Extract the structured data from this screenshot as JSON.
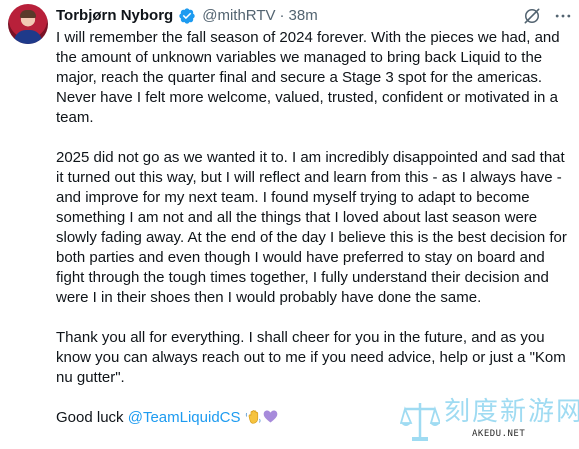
{
  "author": {
    "display_name": "Torbjørn Nyborg",
    "handle": "@mithRTV",
    "separator": "·",
    "time": "38m"
  },
  "icons": {
    "verified": "verified-badge-icon",
    "grok": "grok-icon",
    "more": "more-options-icon"
  },
  "colors": {
    "text": "#0f1419",
    "secondary": "#536471",
    "link": "#1d9bf0",
    "verified": "#1d9bf0"
  },
  "tweet": {
    "paragraphs": [
      "I will remember the fall season of 2024 forever. With the pieces we had, and the amount of unknown variables we managed to bring back Liquid to the major, reach the quarter final and secure a Stage 3 spot for the americas. Never have I felt more welcome, valued, trusted, confident or motivated in a team.",
      "2025 did not go as we wanted it to. I am incredibly disappointed and sad that it turned out this way, but I will reflect and learn from this - as I always have - and improve for my next team. I found myself trying to adapt to become something I am not and all the things that I loved about last season were slowly fading away. At the end of the day I believe this is the best decision for both parties and even though I would have preferred to stay on board and fight through the tough times together, I fully understand their decision and were I in their shoes then I would probably have done the same.",
      "Thank you all for everything. I shall cheer for you in the future, and as you know you can always reach out to me if you need advice, help or just a \"Kom nu gutter\"."
    ],
    "closing_text": "Good luck ",
    "mention": "@TeamLiquidCS",
    "emojis": [
      "waving-hand-emoji",
      "purple-heart-emoji"
    ]
  },
  "watermark": {
    "logo": "scales-logo",
    "text": "刻度新游网",
    "subtext": "AKEDU.NET"
  }
}
